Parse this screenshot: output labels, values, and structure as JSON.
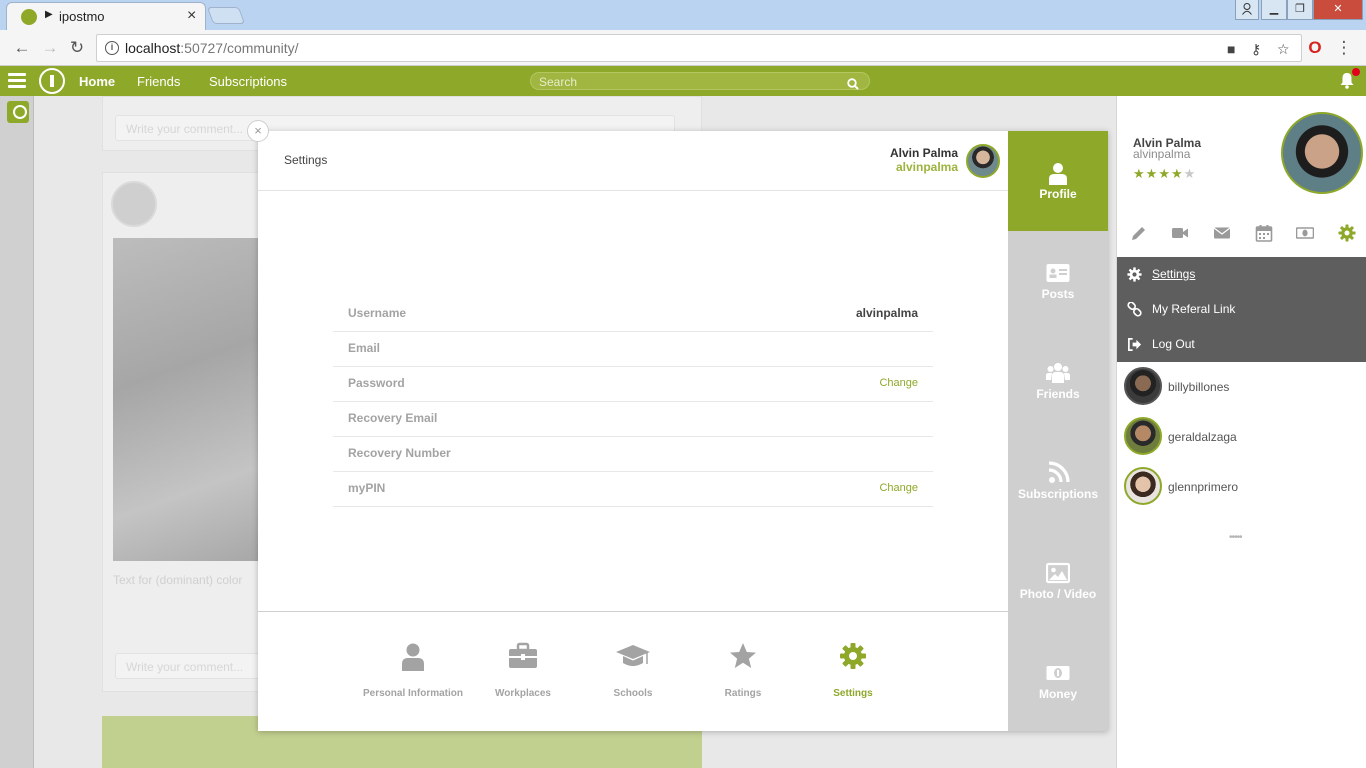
{
  "browser": {
    "tab_title": "ipostmo",
    "url_host": "localhost",
    "url_rest": ":50727/community/"
  },
  "navbar": {
    "home": "Home",
    "friends": "Friends",
    "subscriptions": "Subscriptions",
    "search_placeholder": "Search"
  },
  "modal": {
    "title": "Settings",
    "user_name": "Alvin Palma",
    "user_handle": "alvinpalma",
    "rows": [
      {
        "label": "Username",
        "value": "alvinpalma",
        "action": ""
      },
      {
        "label": "Email",
        "value": "",
        "action": ""
      },
      {
        "label": "Password",
        "value": "",
        "action": "Change"
      },
      {
        "label": "Recovery Email",
        "value": "",
        "action": ""
      },
      {
        "label": "Recovery Number",
        "value": "",
        "action": ""
      },
      {
        "label": "myPIN",
        "value": "",
        "action": "Change"
      }
    ],
    "footer_tabs": [
      {
        "label": "Personal Information",
        "icon": "user-icon"
      },
      {
        "label": "Workplaces",
        "icon": "briefcase-icon"
      },
      {
        "label": "Schools",
        "icon": "graduation-cap-icon"
      },
      {
        "label": "Ratings",
        "icon": "star-icon"
      },
      {
        "label": "Settings",
        "icon": "gear-icon",
        "active": true
      }
    ],
    "side_tabs": [
      {
        "label": "Profile",
        "icon": "user-icon",
        "active": true
      },
      {
        "label": "Posts",
        "icon": "id-card-icon"
      },
      {
        "label": "Friends",
        "icon": "users-icon"
      },
      {
        "label": "Subscriptions",
        "icon": "rss-icon"
      },
      {
        "label": "Photo / Video",
        "icon": "image-icon"
      },
      {
        "label": "Money",
        "icon": "money-icon"
      }
    ]
  },
  "right_panel": {
    "name": "Alvin Palma",
    "handle": "alvinpalma",
    "rating_stars": 4,
    "rating_max": 5,
    "menu": [
      {
        "label": "Settings",
        "icon": "gear-icon"
      },
      {
        "label": "My Referal Link",
        "icon": "link-icon"
      },
      {
        "label": "Log Out",
        "icon": "sign-out-icon"
      }
    ],
    "friends": [
      "billybillones",
      "geraldalzaga",
      "glennprimero"
    ],
    "more": "•••••"
  },
  "feed": {
    "comment_placeholder": "Write your comment...",
    "caption": "Text for (dominant) color"
  },
  "colors": {
    "brand_green": "#8ea82a",
    "menu_gray": "#5e5e5e",
    "side_tab_gray": "#cfcfcf"
  }
}
